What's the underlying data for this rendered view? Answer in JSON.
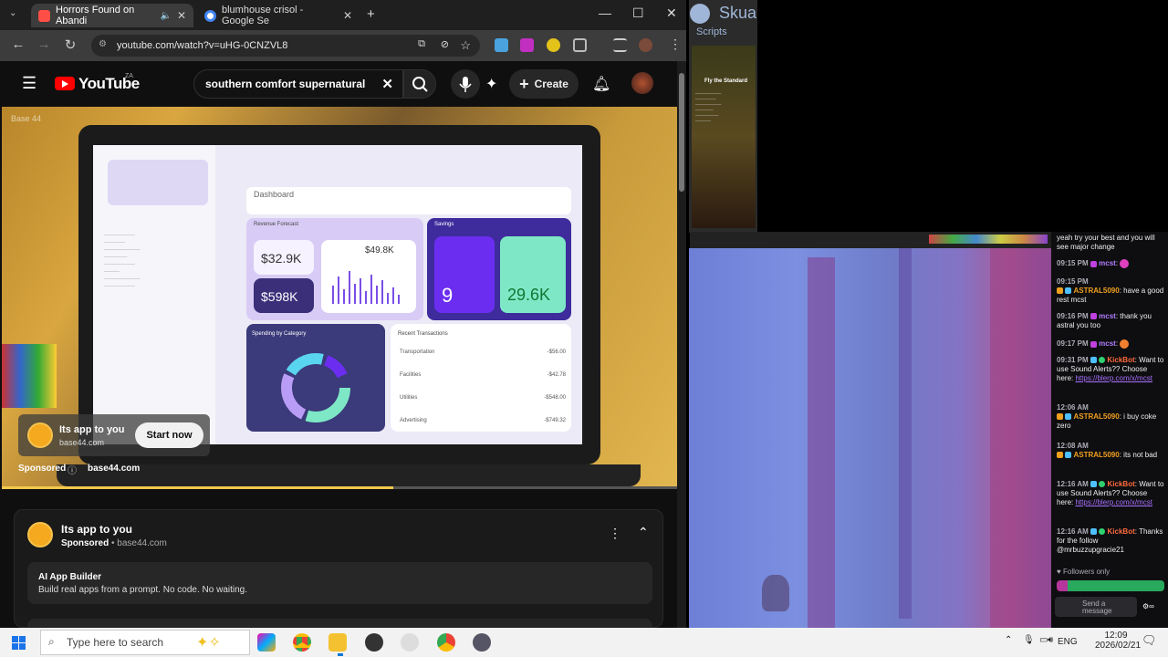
{
  "browser": {
    "tabs": [
      {
        "title": "Horrors Found on Abandi",
        "icon": "youtube-favicon"
      },
      {
        "title": "blumhouse crisol - Google Se",
        "icon": "google-favicon"
      }
    ],
    "url": "youtube.com/watch?v=uHG-0CNZVL8"
  },
  "youtube": {
    "logo_text": "YouTube",
    "region": "ZA",
    "search_value": "southern comfort supernatural",
    "create_label": "Create",
    "video": {
      "watermark": "Base 44",
      "progress_fraction": 0.58,
      "ad_overlay": {
        "title": "Its app to you",
        "domain": "base44.com",
        "cta": "Start now",
        "sponsored": "Sponsored",
        "sponsored_domain": "base44.com"
      },
      "laptop_screen": {
        "dashboard_title": "Dashboard",
        "revenue_label": "Revenue Forecast",
        "revenue_value": "$32.9K",
        "forecast_value": "$598K",
        "chart_value": "$49.8K",
        "savings_label": "Savings",
        "savings_count": "9",
        "savings_value": "29.6K",
        "spending_label": "Spending by Category",
        "recent_label": "Recent Transactions",
        "transactions": [
          {
            "name": "Transportation",
            "amount": "-$56.00"
          },
          {
            "name": "Facilities",
            "amount": "-$42.78"
          },
          {
            "name": "Utilities",
            "amount": "-$548.00"
          },
          {
            "name": "Advertising",
            "amount": "-$749.32"
          }
        ]
      }
    },
    "ad_card": {
      "title": "Its app to you",
      "sponsored": "Sponsored",
      "domain": "base44.com",
      "headline": "AI App Builder",
      "description": "Build real apps from a prompt. No code. No waiting."
    }
  },
  "twitch": {
    "game_window_title": "Skua",
    "game_menu": "Scripts",
    "game_quest": "Fly the Standard",
    "chat": [
      {
        "text": "yeah try your best and you will see major change"
      },
      {
        "time": "09:15 PM",
        "user": "mcst",
        "text": ""
      },
      {
        "time": "09:15 PM",
        "user": "ASTRAL5090",
        "text": "have a good rest mcst"
      },
      {
        "time": "09:16 PM",
        "user": "mcst",
        "text": "thank you astral you too"
      },
      {
        "time": "09:17 PM",
        "user": "mcst",
        "text": ""
      },
      {
        "time": "09:31 PM",
        "user": "KickBot",
        "text": "Want to use Sound Alerts?? Choose here:",
        "link": "https://blerp.com/x/mcst"
      },
      {
        "time": "12:06 AM",
        "user": "ASTRAL5090",
        "text": "i buy coke zero"
      },
      {
        "time": "12:08 AM",
        "user": "ASTRAL5090",
        "text": "its not bad"
      },
      {
        "time": "12:16 AM",
        "user": "KickBot",
        "text": "Want to use Sound Alerts?? Choose here:",
        "link": "https://blerp.com/x/mcst"
      },
      {
        "time": "12:16 AM",
        "user": "KickBot",
        "text": "Thanks for the follow @mrbuzzupgracie21"
      }
    ],
    "followers_only": "Followers only",
    "send_placeholder": "Send a message"
  },
  "taskbar": {
    "search_placeholder": "Type here to search",
    "lang": "ENG",
    "time": "12:09",
    "date": "2026/02/21"
  },
  "colors": {
    "youtube_red": "#ff0000",
    "twitch_purple": "#a970ff",
    "base44_orange": "#f4a91f"
  }
}
